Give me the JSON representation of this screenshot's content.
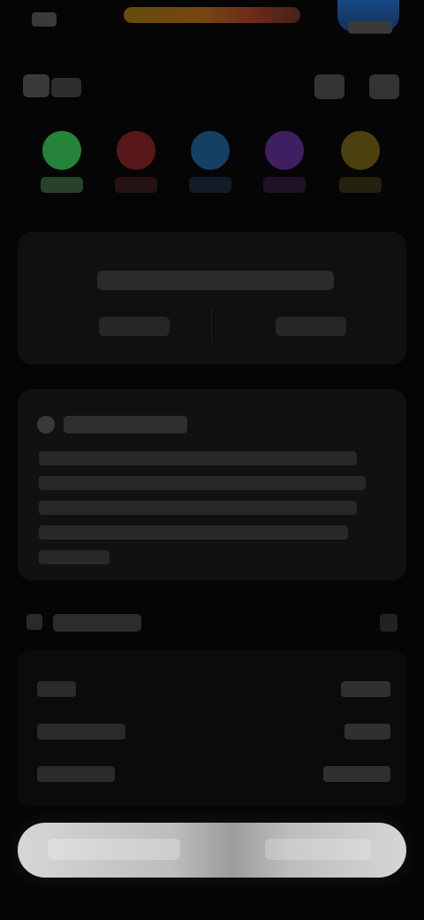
{
  "colors": {
    "background": "#050505",
    "card": "#111111",
    "accent_green": "#2fae4a",
    "accent_red": "#7a1f24",
    "accent_blue": "#1d5a8f",
    "accent_purple": "#5a2a8a",
    "accent_yellow": "#6a5a12"
  },
  "statusbar": {},
  "header": {
    "icons": [
      "back-icon",
      "action-icon",
      "more-icon"
    ]
  },
  "swatches": [
    {
      "color": "#2fae4a",
      "icon": "green-swatch"
    },
    {
      "color": "#7a1f24",
      "icon": "red-swatch"
    },
    {
      "color": "#1d5a8f",
      "icon": "blue-swatch"
    },
    {
      "color": "#5a2a8a",
      "icon": "purple-swatch"
    },
    {
      "color": "#6a5a12",
      "icon": "yellow-swatch"
    }
  ],
  "summary_card": {},
  "info_card": {},
  "details_section": {},
  "details_rows": [
    {},
    {},
    {}
  ],
  "cta": {}
}
